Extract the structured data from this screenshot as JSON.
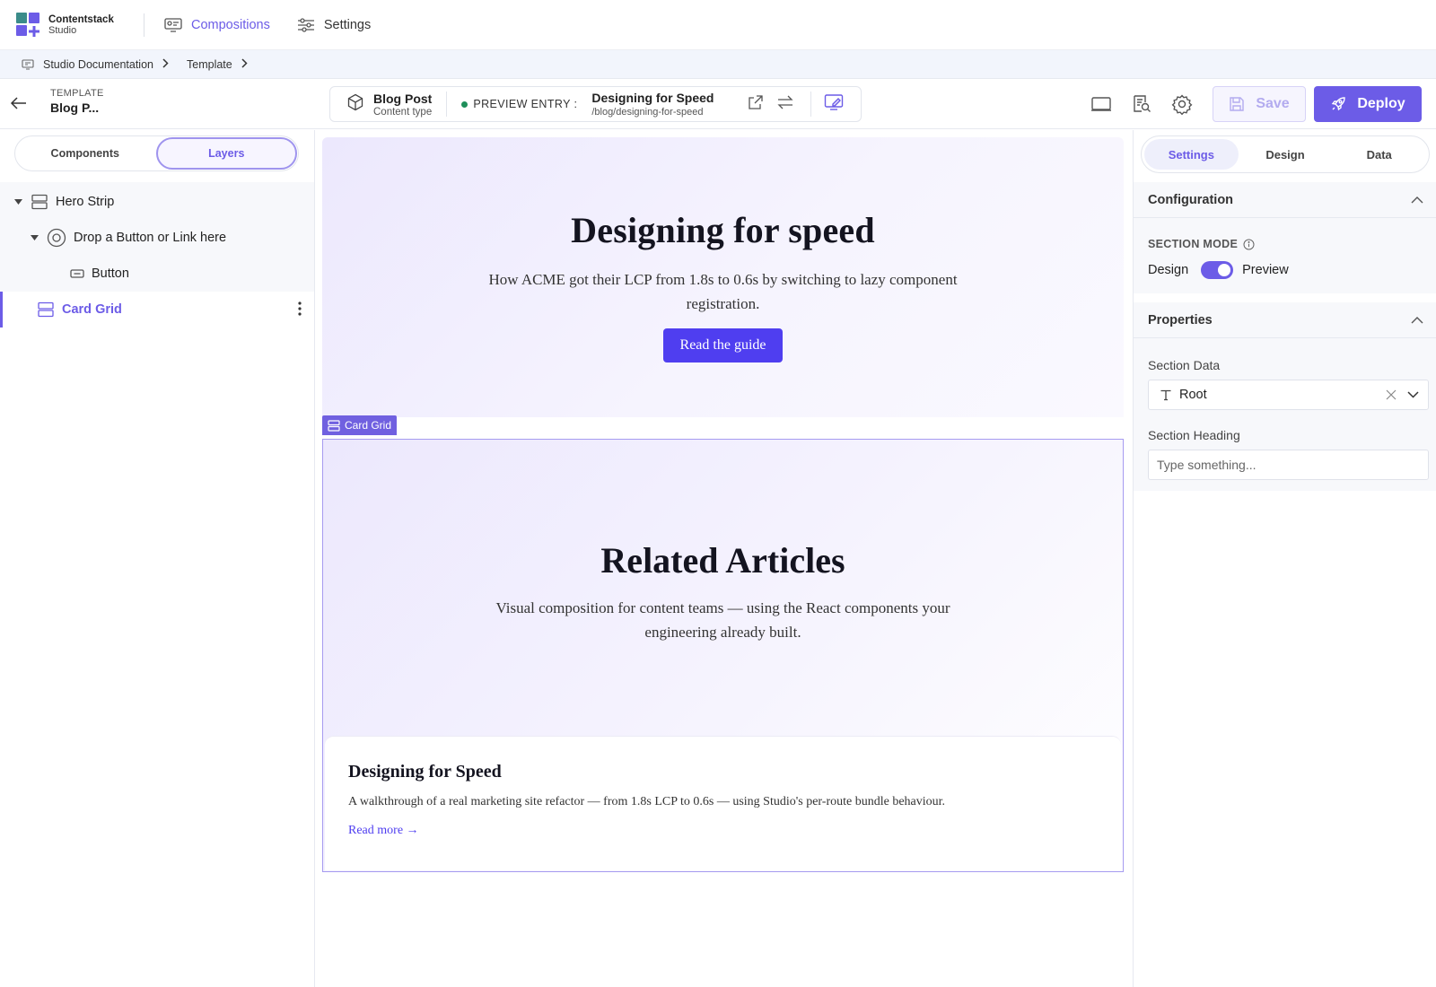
{
  "app": {
    "brand_name": "Contentstack",
    "brand_sub": "Studio",
    "colors": {
      "accent": "#6c5ce7",
      "button": "#4f3ef0",
      "success": "#1e8f5a"
    }
  },
  "nav": {
    "items": [
      {
        "label": "Compositions",
        "icon": "compositions-icon",
        "active": true
      },
      {
        "label": "Settings",
        "icon": "sliders-icon",
        "active": false
      }
    ]
  },
  "breadcrumb": {
    "items": [
      "Studio Documentation",
      "Template"
    ]
  },
  "toolbar": {
    "template_kicker": "TEMPLATE",
    "template_name": "Blog P...",
    "content_type": {
      "name": "Blog Post",
      "sub": "Content type"
    },
    "preview_label": "PREVIEW ENTRY :",
    "preview_entry": {
      "title": "Designing for Speed",
      "url": "/blog/designing-for-speed"
    },
    "save_label": "Save",
    "deploy_label": "Deploy"
  },
  "left_panel": {
    "tabs": [
      {
        "label": "Components",
        "active": false
      },
      {
        "label": "Layers",
        "active": true
      }
    ],
    "layers": [
      {
        "label": "Hero Strip",
        "icon": "section-icon",
        "depth": 0,
        "expanded": true
      },
      {
        "label": "Drop a Button or Link here",
        "icon": "slot-icon",
        "depth": 1,
        "expanded": true
      },
      {
        "label": "Button",
        "icon": "button-icon",
        "depth": 2
      },
      {
        "label": "Card Grid",
        "icon": "section-icon",
        "depth": 0,
        "selected": true
      }
    ]
  },
  "canvas": {
    "hero": {
      "title": "Designing for speed",
      "subtitle": "How ACME got their LCP from 1.8s to 0.6s by switching to lazy component registration.",
      "button_label": "Read the guide"
    },
    "selection_tag": "Card Grid",
    "card_grid": {
      "title": "Related Articles",
      "subtitle": "Visual composition for content teams — using the React components your engineering already built.",
      "cards": [
        {
          "title": "Designing for Speed",
          "excerpt": "A walkthrough of a real marketing site refactor — from 1.8s LCP to 0.6s — using Studio's per-route bundle behaviour.",
          "link": "Read more →"
        }
      ]
    }
  },
  "right_panel": {
    "tabs": [
      {
        "label": "Settings",
        "active": true
      },
      {
        "label": "Design",
        "active": false
      },
      {
        "label": "Data",
        "active": false
      }
    ],
    "configuration": {
      "title": "Configuration",
      "section_mode_label": "SECTION MODE",
      "mode_left": "Design",
      "mode_right": "Preview",
      "toggle_on": true
    },
    "properties": {
      "title": "Properties",
      "section_data_label": "Section Data",
      "section_data_value": "Root",
      "section_heading_label": "Section Heading",
      "section_heading_placeholder": "Type something...",
      "section_heading_value": ""
    }
  }
}
